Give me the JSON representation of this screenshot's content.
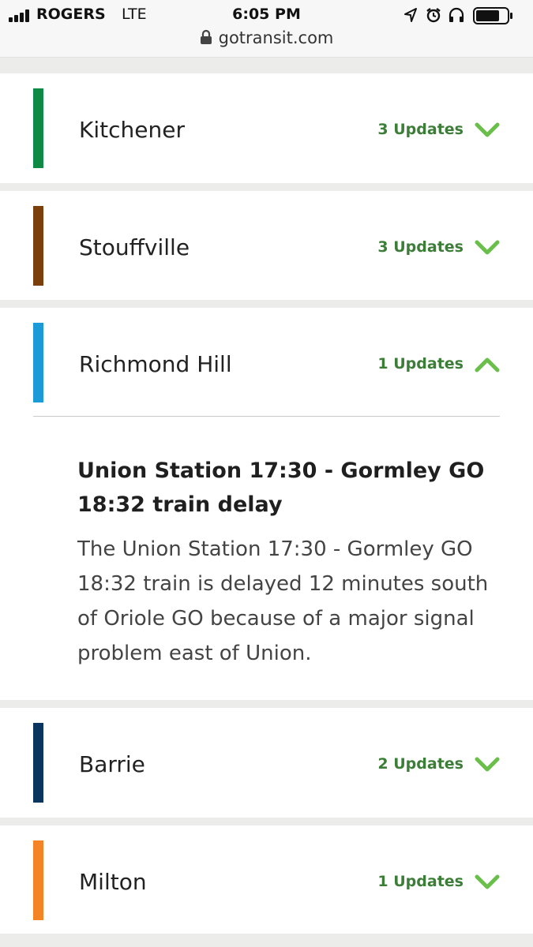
{
  "status_bar": {
    "carrier": "ROGERS",
    "network": "LTE",
    "time": "6:05 PM"
  },
  "browser": {
    "url": "gotransit.com"
  },
  "colors": {
    "update_green": "#3c7d37",
    "chevron_green": "#6abf4b"
  },
  "lines": [
    {
      "name": "Kitchener",
      "updates": "3 Updates",
      "color": "#0f8a45",
      "expanded": false
    },
    {
      "name": "Stouffville",
      "updates": "3 Updates",
      "color": "#7a3f0b",
      "expanded": false
    },
    {
      "name": "Richmond Hill",
      "updates": "1 Updates",
      "color": "#1a9ad6",
      "expanded": true
    },
    {
      "name": "Barrie",
      "updates": "2 Updates",
      "color": "#0b3561",
      "expanded": false
    },
    {
      "name": "Milton",
      "updates": "1 Updates",
      "color": "#f58426",
      "expanded": false
    }
  ],
  "alert": {
    "title": "Union Station 17:30 - Gormley GO 18:32 train delay",
    "body": "The Union Station 17:30 - Gormley GO 18:32 train is delayed 12 minutes south of Oriole GO because of a major signal problem east of Union."
  }
}
